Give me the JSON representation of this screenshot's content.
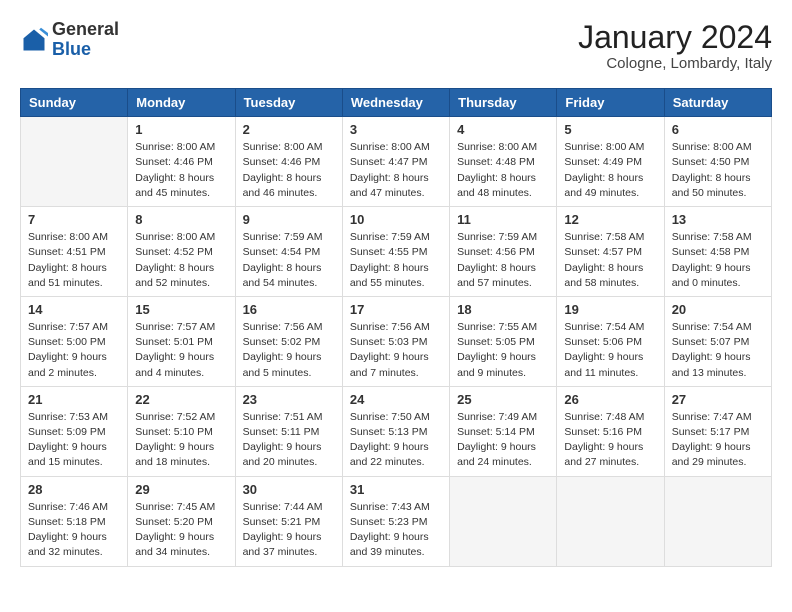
{
  "header": {
    "logo": {
      "general": "General",
      "blue": "Blue"
    },
    "title": "January 2024",
    "subtitle": "Cologne, Lombardy, Italy"
  },
  "calendar": {
    "days_of_week": [
      "Sunday",
      "Monday",
      "Tuesday",
      "Wednesday",
      "Thursday",
      "Friday",
      "Saturday"
    ],
    "weeks": [
      [
        {
          "day": "",
          "info": ""
        },
        {
          "day": "1",
          "info": "Sunrise: 8:00 AM\nSunset: 4:46 PM\nDaylight: 8 hours\nand 45 minutes."
        },
        {
          "day": "2",
          "info": "Sunrise: 8:00 AM\nSunset: 4:46 PM\nDaylight: 8 hours\nand 46 minutes."
        },
        {
          "day": "3",
          "info": "Sunrise: 8:00 AM\nSunset: 4:47 PM\nDaylight: 8 hours\nand 47 minutes."
        },
        {
          "day": "4",
          "info": "Sunrise: 8:00 AM\nSunset: 4:48 PM\nDaylight: 8 hours\nand 48 minutes."
        },
        {
          "day": "5",
          "info": "Sunrise: 8:00 AM\nSunset: 4:49 PM\nDaylight: 8 hours\nand 49 minutes."
        },
        {
          "day": "6",
          "info": "Sunrise: 8:00 AM\nSunset: 4:50 PM\nDaylight: 8 hours\nand 50 minutes."
        }
      ],
      [
        {
          "day": "7",
          "info": "Sunrise: 8:00 AM\nSunset: 4:51 PM\nDaylight: 8 hours\nand 51 minutes."
        },
        {
          "day": "8",
          "info": "Sunrise: 8:00 AM\nSunset: 4:52 PM\nDaylight: 8 hours\nand 52 minutes."
        },
        {
          "day": "9",
          "info": "Sunrise: 7:59 AM\nSunset: 4:54 PM\nDaylight: 8 hours\nand 54 minutes."
        },
        {
          "day": "10",
          "info": "Sunrise: 7:59 AM\nSunset: 4:55 PM\nDaylight: 8 hours\nand 55 minutes."
        },
        {
          "day": "11",
          "info": "Sunrise: 7:59 AM\nSunset: 4:56 PM\nDaylight: 8 hours\nand 57 minutes."
        },
        {
          "day": "12",
          "info": "Sunrise: 7:58 AM\nSunset: 4:57 PM\nDaylight: 8 hours\nand 58 minutes."
        },
        {
          "day": "13",
          "info": "Sunrise: 7:58 AM\nSunset: 4:58 PM\nDaylight: 9 hours\nand 0 minutes."
        }
      ],
      [
        {
          "day": "14",
          "info": "Sunrise: 7:57 AM\nSunset: 5:00 PM\nDaylight: 9 hours\nand 2 minutes."
        },
        {
          "day": "15",
          "info": "Sunrise: 7:57 AM\nSunset: 5:01 PM\nDaylight: 9 hours\nand 4 minutes."
        },
        {
          "day": "16",
          "info": "Sunrise: 7:56 AM\nSunset: 5:02 PM\nDaylight: 9 hours\nand 5 minutes."
        },
        {
          "day": "17",
          "info": "Sunrise: 7:56 AM\nSunset: 5:03 PM\nDaylight: 9 hours\nand 7 minutes."
        },
        {
          "day": "18",
          "info": "Sunrise: 7:55 AM\nSunset: 5:05 PM\nDaylight: 9 hours\nand 9 minutes."
        },
        {
          "day": "19",
          "info": "Sunrise: 7:54 AM\nSunset: 5:06 PM\nDaylight: 9 hours\nand 11 minutes."
        },
        {
          "day": "20",
          "info": "Sunrise: 7:54 AM\nSunset: 5:07 PM\nDaylight: 9 hours\nand 13 minutes."
        }
      ],
      [
        {
          "day": "21",
          "info": "Sunrise: 7:53 AM\nSunset: 5:09 PM\nDaylight: 9 hours\nand 15 minutes."
        },
        {
          "day": "22",
          "info": "Sunrise: 7:52 AM\nSunset: 5:10 PM\nDaylight: 9 hours\nand 18 minutes."
        },
        {
          "day": "23",
          "info": "Sunrise: 7:51 AM\nSunset: 5:11 PM\nDaylight: 9 hours\nand 20 minutes."
        },
        {
          "day": "24",
          "info": "Sunrise: 7:50 AM\nSunset: 5:13 PM\nDaylight: 9 hours\nand 22 minutes."
        },
        {
          "day": "25",
          "info": "Sunrise: 7:49 AM\nSunset: 5:14 PM\nDaylight: 9 hours\nand 24 minutes."
        },
        {
          "day": "26",
          "info": "Sunrise: 7:48 AM\nSunset: 5:16 PM\nDaylight: 9 hours\nand 27 minutes."
        },
        {
          "day": "27",
          "info": "Sunrise: 7:47 AM\nSunset: 5:17 PM\nDaylight: 9 hours\nand 29 minutes."
        }
      ],
      [
        {
          "day": "28",
          "info": "Sunrise: 7:46 AM\nSunset: 5:18 PM\nDaylight: 9 hours\nand 32 minutes."
        },
        {
          "day": "29",
          "info": "Sunrise: 7:45 AM\nSunset: 5:20 PM\nDaylight: 9 hours\nand 34 minutes."
        },
        {
          "day": "30",
          "info": "Sunrise: 7:44 AM\nSunset: 5:21 PM\nDaylight: 9 hours\nand 37 minutes."
        },
        {
          "day": "31",
          "info": "Sunrise: 7:43 AM\nSunset: 5:23 PM\nDaylight: 9 hours\nand 39 minutes."
        },
        {
          "day": "",
          "info": ""
        },
        {
          "day": "",
          "info": ""
        },
        {
          "day": "",
          "info": ""
        }
      ]
    ]
  }
}
